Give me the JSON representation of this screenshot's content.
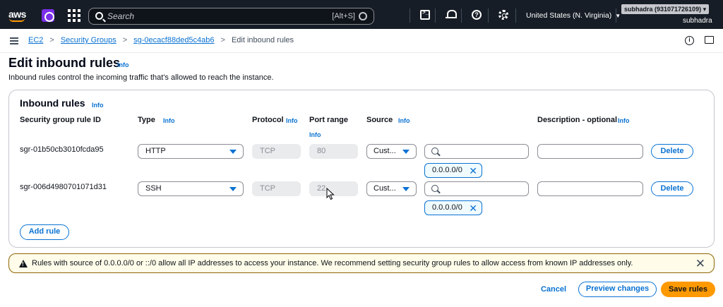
{
  "topbar": {
    "logo": "aws",
    "search_placeholder": "Search",
    "search_shortcut": "[Alt+S]",
    "region": "United States (N. Virginia)",
    "account": "subhadra (931071726109)",
    "user": "subhadra",
    "icons": [
      "services-icon",
      "apps-grid-icon",
      "search-icon",
      "cloudshell-icon",
      "bell-icon",
      "help-icon",
      "gear-icon"
    ]
  },
  "breadcrumb": {
    "items": [
      "EC2",
      "Security Groups",
      "sg-0ecacf88ded5c4ab6"
    ],
    "current": "Edit inbound rules"
  },
  "page": {
    "title": "Edit inbound rules",
    "info": "Info",
    "description": "Inbound rules control the incoming traffic that's allowed to reach the instance."
  },
  "panel": {
    "title": "Inbound rules",
    "info": "Info",
    "columns": {
      "rule_id": "Security group rule ID",
      "type": "Type",
      "protocol": "Protocol",
      "port_range": "Port range",
      "source": "Source",
      "description": "Description - optional",
      "info": "Info"
    },
    "rules": [
      {
        "id": "sgr-01b50cb3010fcda95",
        "type": "HTTP",
        "protocol": "TCP",
        "port": "80",
        "source": "Cust...",
        "cidr": "0.0.0.0/0",
        "delete": "Delete"
      },
      {
        "id": "sgr-006d4980701071d31",
        "type": "SSH",
        "protocol": "TCP",
        "port": "22",
        "source": "Cust...",
        "cidr": "0.0.0.0/0",
        "delete": "Delete"
      }
    ],
    "add_rule": "Add rule"
  },
  "warning": {
    "text": "Rules with source of 0.0.0.0/0 or ::/0 allow all IP addresses to access your instance. We recommend setting security group rules to allow access from known IP addresses only."
  },
  "footer": {
    "cancel": "Cancel",
    "preview": "Preview changes",
    "save": "Save rules"
  }
}
